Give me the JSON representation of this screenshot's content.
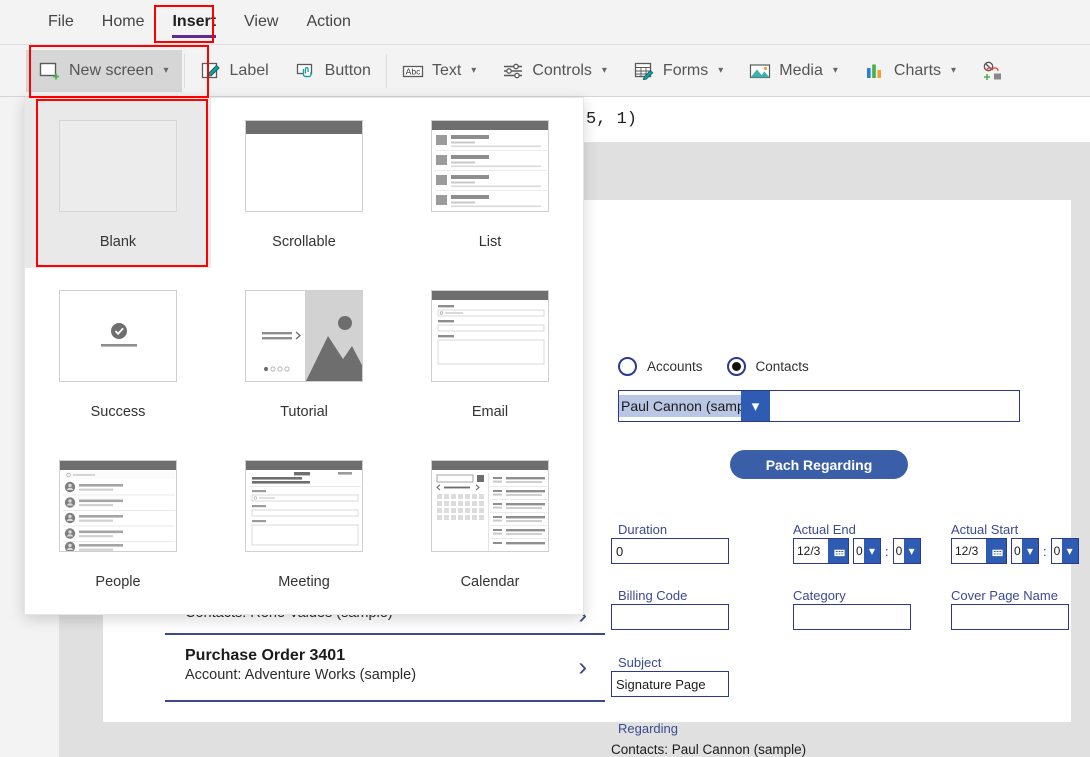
{
  "app": {
    "name": "Power Apps Studio",
    "accent_purple": "#5c2d91",
    "accent_blue": "#2b3990",
    "annotation_color": "#fe0000"
  },
  "menubar": {
    "items": [
      {
        "label": "File",
        "active": false
      },
      {
        "label": "Home",
        "active": false
      },
      {
        "label": "Insert",
        "active": true
      },
      {
        "label": "View",
        "active": false
      },
      {
        "label": "Action",
        "active": false
      }
    ]
  },
  "ribbon": {
    "items": [
      {
        "label": "New screen",
        "icon": "new-screen-icon",
        "has_chevron": true,
        "selected": true
      },
      {
        "label": "Label",
        "icon": "label-icon",
        "has_chevron": false,
        "selected": false
      },
      {
        "label": "Button",
        "icon": "button-icon",
        "has_chevron": false,
        "selected": false
      },
      {
        "label": "Text",
        "icon": "text-abc-icon",
        "has_chevron": true,
        "selected": false
      },
      {
        "label": "Controls",
        "icon": "controls-sliders-icon",
        "has_chevron": true,
        "selected": false
      },
      {
        "label": "Forms",
        "icon": "forms-grid-icon",
        "has_chevron": true,
        "selected": false
      },
      {
        "label": "Media",
        "icon": "media-picture-icon",
        "has_chevron": true,
        "selected": false
      },
      {
        "label": "Charts",
        "icon": "charts-bar-icon",
        "has_chevron": true,
        "selected": false
      },
      {
        "label": "",
        "icon": "icons-shapes-icon",
        "has_chevron": false,
        "selected": false
      }
    ]
  },
  "new_screen_panel": {
    "tiles": [
      {
        "label": "Blank",
        "thumb": "blank",
        "selected": true
      },
      {
        "label": "Scrollable",
        "thumb": "scrollable",
        "selected": false
      },
      {
        "label": "List",
        "thumb": "list",
        "selected": false
      },
      {
        "label": "Success",
        "thumb": "success",
        "selected": false
      },
      {
        "label": "Tutorial",
        "thumb": "tutorial",
        "selected": false
      },
      {
        "label": "Email",
        "thumb": "email",
        "selected": false
      },
      {
        "label": "People",
        "thumb": "people",
        "selected": false
      },
      {
        "label": "Meeting",
        "thumb": "meeting",
        "selected": false
      },
      {
        "label": "Calendar",
        "thumb": "calendar",
        "selected": false
      }
    ]
  },
  "formula_bar": {
    "visible_text": "5, 1)",
    "number_token": "1"
  },
  "app_preview": {
    "radio_group": {
      "options": [
        {
          "label": "Accounts",
          "checked": false
        },
        {
          "label": "Contacts",
          "checked": true
        }
      ]
    },
    "combobox": {
      "value": "Paul Cannon (sample)",
      "chevron": "chevron-down"
    },
    "patch_button": {
      "label": "Pach Regarding"
    },
    "fields": [
      {
        "name": "duration",
        "label": "Duration",
        "value": "0",
        "type": "text"
      },
      {
        "name": "actual-end",
        "label": "Actual End",
        "date": "12/3",
        "hour": "0",
        "minute": "0",
        "type": "datetime"
      },
      {
        "name": "actual-start",
        "label": "Actual Start",
        "date": "12/3",
        "hour": "0",
        "minute": "0",
        "type": "datetime"
      },
      {
        "name": "billing-code",
        "label": "Billing Code",
        "value": "",
        "type": "text"
      },
      {
        "name": "category",
        "label": "Category",
        "value": "",
        "type": "text"
      },
      {
        "name": "cover-page-name",
        "label": "Cover Page Name",
        "value": "",
        "type": "text"
      },
      {
        "name": "subject",
        "label": "Subject",
        "value": "Signature Page",
        "type": "text"
      }
    ],
    "regarding": {
      "label": "Regarding",
      "value": "Contacts: Paul Cannon (sample)"
    },
    "gallery": [
      {
        "title": "",
        "subtitle": "Contacts: Rene Valdes (sample)",
        "chevron": "›"
      },
      {
        "title": "Purchase Order 3401",
        "subtitle": "Account: Adventure Works (sample)",
        "chevron": "›"
      }
    ]
  },
  "annotations": [
    {
      "name": "insert-tab-highlight"
    },
    {
      "name": "new-screen-button-highlight"
    },
    {
      "name": "blank-tile-highlight"
    }
  ]
}
